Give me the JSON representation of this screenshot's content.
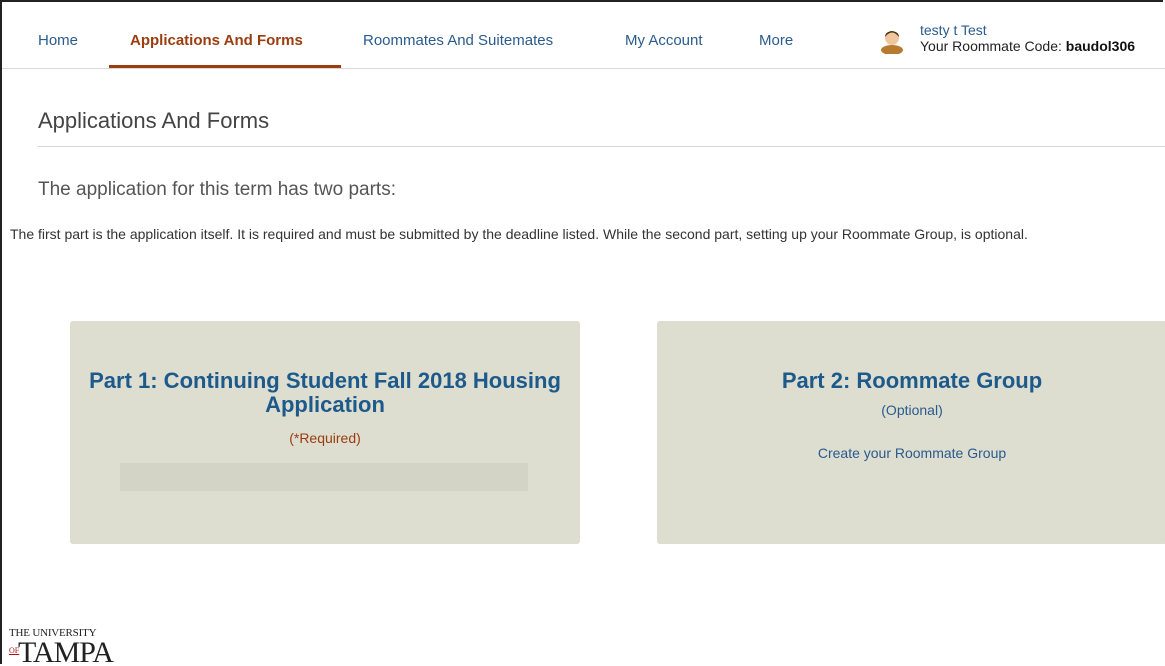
{
  "nav": {
    "items": [
      {
        "label": "Home",
        "active": false
      },
      {
        "label": "Applications And Forms",
        "active": true
      },
      {
        "label": "Roommates And Suitemates",
        "active": false
      },
      {
        "label": "My Account",
        "active": false
      },
      {
        "label": "More",
        "active": false
      }
    ],
    "user": {
      "name": "testy t Test",
      "code_label": "Your Roommate Code:",
      "code_value": "baudol306",
      "avatar_icon": "user-avatar-icon"
    }
  },
  "page": {
    "title": "Applications And Forms",
    "subtitle": "The application for this term has two parts:",
    "description": "The first part is the application itself. It is required and must be submitted by the deadline listed. While the second part, setting up your Roommate Group, is optional."
  },
  "cards": {
    "part1": {
      "title": "Part 1: Continuing Student Fall 2018 Housing Application",
      "note": "(*Required)"
    },
    "part2": {
      "title": "Part 2: Roommate Group",
      "note": "(Optional)",
      "link": "Create your Roommate Group"
    }
  },
  "logo": {
    "top": "THE UNIVERSITY",
    "of": "OF",
    "main": "TAMPA"
  },
  "colors": {
    "link": "#2a5b8e",
    "active": "#9a3d10",
    "card_bg": "#ddddd0",
    "card_title": "#1d5a8c"
  }
}
